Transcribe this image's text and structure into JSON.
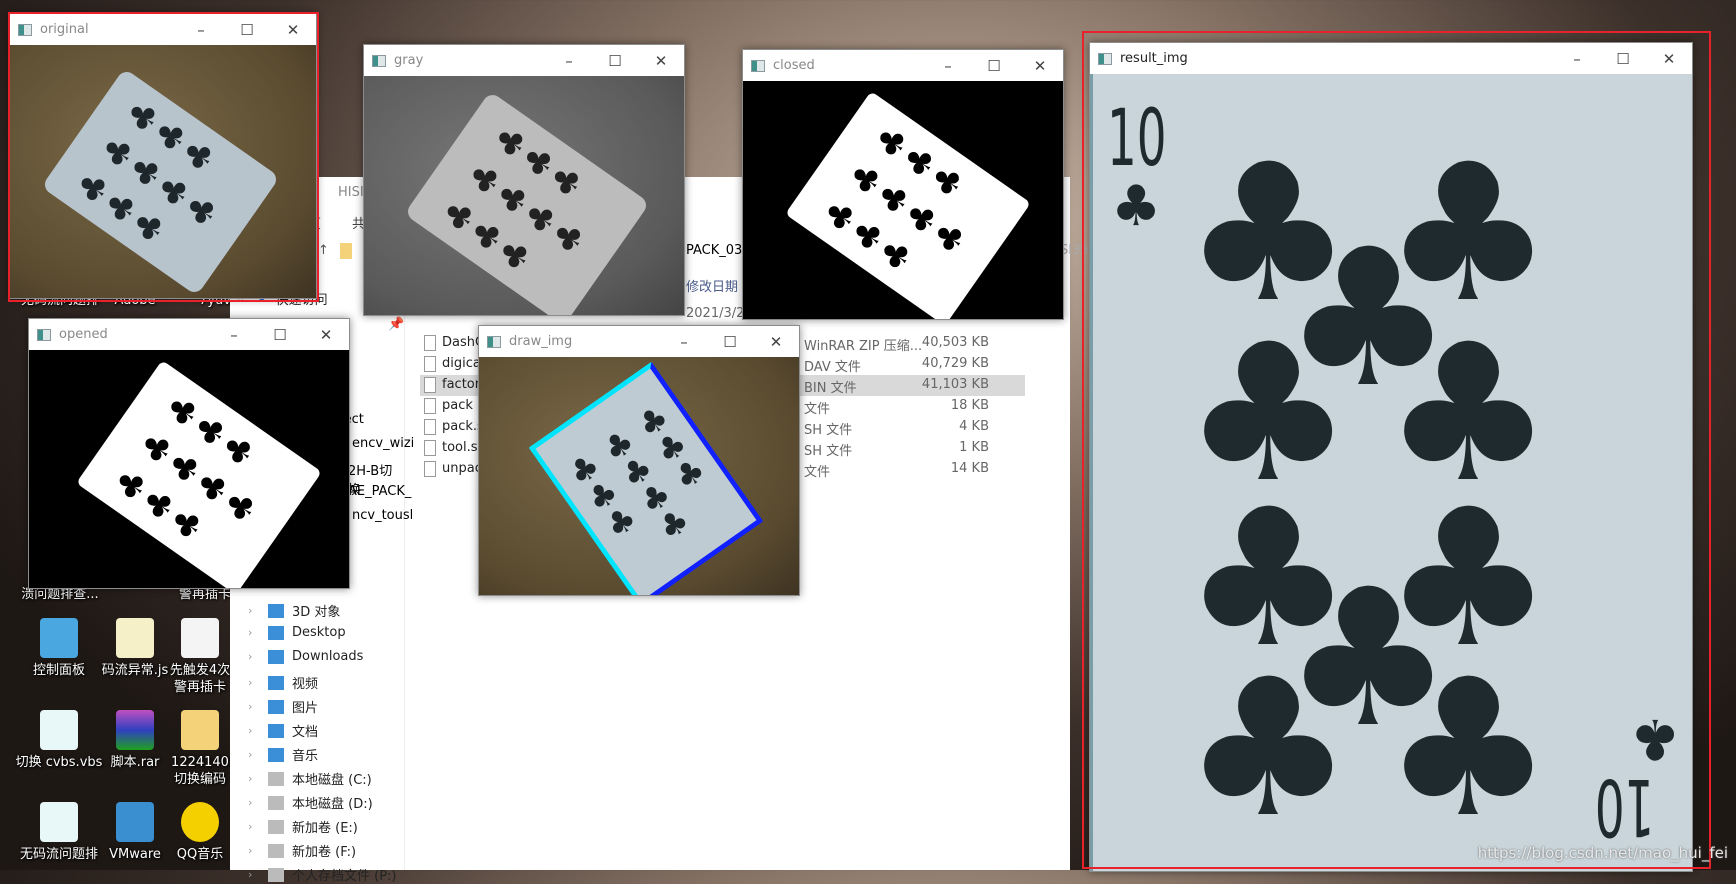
{
  "windows": {
    "original": {
      "title": "original"
    },
    "gray": {
      "title": "gray"
    },
    "closed": {
      "title": "closed"
    },
    "opened": {
      "title": "opened"
    },
    "draw_img": {
      "title": "draw_img"
    },
    "result_img": {
      "title": "result_img"
    }
  },
  "controls": {
    "minimize": "–",
    "maximize": "☐",
    "close": "✕"
  },
  "card": {
    "rank": "10",
    "suit": "♣"
  },
  "explorer": {
    "title_fragment": "HISI",
    "ribbon": [
      "页",
      "共"
    ],
    "path_fragment": "PACK_032",
    "right_fragment": "SI351",
    "column_modified": "修改日期",
    "date_fragment": "2021/3/23",
    "quick_access": "快速访问",
    "nav_fragments": [
      "ject",
      "encv_wizi",
      "2H-B切换",
      "AE_PACK_",
      "ncv_tousl"
    ],
    "nav": [
      {
        "label": "3D 对象",
        "icon": "3d-objects-icon"
      },
      {
        "label": "Desktop",
        "icon": "desktop-icon"
      },
      {
        "label": "Downloads",
        "icon": "downloads-icon"
      },
      {
        "label": "视频",
        "icon": "video-icon"
      },
      {
        "label": "图片",
        "icon": "pictures-icon"
      },
      {
        "label": "文档",
        "icon": "documents-icon"
      },
      {
        "label": "音乐",
        "icon": "music-icon"
      },
      {
        "label": "本地磁盘 (C:)",
        "icon": "drive-icon"
      },
      {
        "label": "本地磁盘 (D:)",
        "icon": "drive-icon"
      },
      {
        "label": "新加卷 (E:)",
        "icon": "drive-icon"
      },
      {
        "label": "新加卷 (F:)",
        "icon": "drive-icon"
      },
      {
        "label": "个人存档文件 (P:)",
        "icon": "drive-icon"
      }
    ],
    "files": [
      {
        "name": "DashC",
        "type": "WinRAR ZIP 压缩...",
        "size": "40,503 KB"
      },
      {
        "name": "digica",
        "type": "DAV 文件",
        "size": "40,729 KB"
      },
      {
        "name": "factor",
        "type": "BIN 文件",
        "size": "41,103 KB",
        "selected": true
      },
      {
        "name": "pack",
        "type": "文件",
        "size": "18 KB"
      },
      {
        "name": "pack.s",
        "type": "SH 文件",
        "size": "4 KB"
      },
      {
        "name": "tool.sl",
        "type": "SH 文件",
        "size": "1 KB"
      },
      {
        "name": "unpac",
        "type": "文件",
        "size": "14 KB"
      }
    ]
  },
  "desktop": [
    "无码流问题排",
    "Adobe",
    "7yuv",
    "溃问题排查...",
    "警再插卡",
    "控制面板",
    "码流异常.js",
    "先触发4次 警再插卡",
    "切换 cvbs.vbs",
    "脚本.rar",
    "1224140 切换编码",
    "无码流问题排",
    "VMware",
    "QQ音乐"
  ],
  "watermark": "https://blog.csdn.net/mao_hui_fei",
  "colors": {
    "highlight": "#e8212b",
    "contour_outer": "#0000ff",
    "contour_inner": "#00ffff"
  }
}
